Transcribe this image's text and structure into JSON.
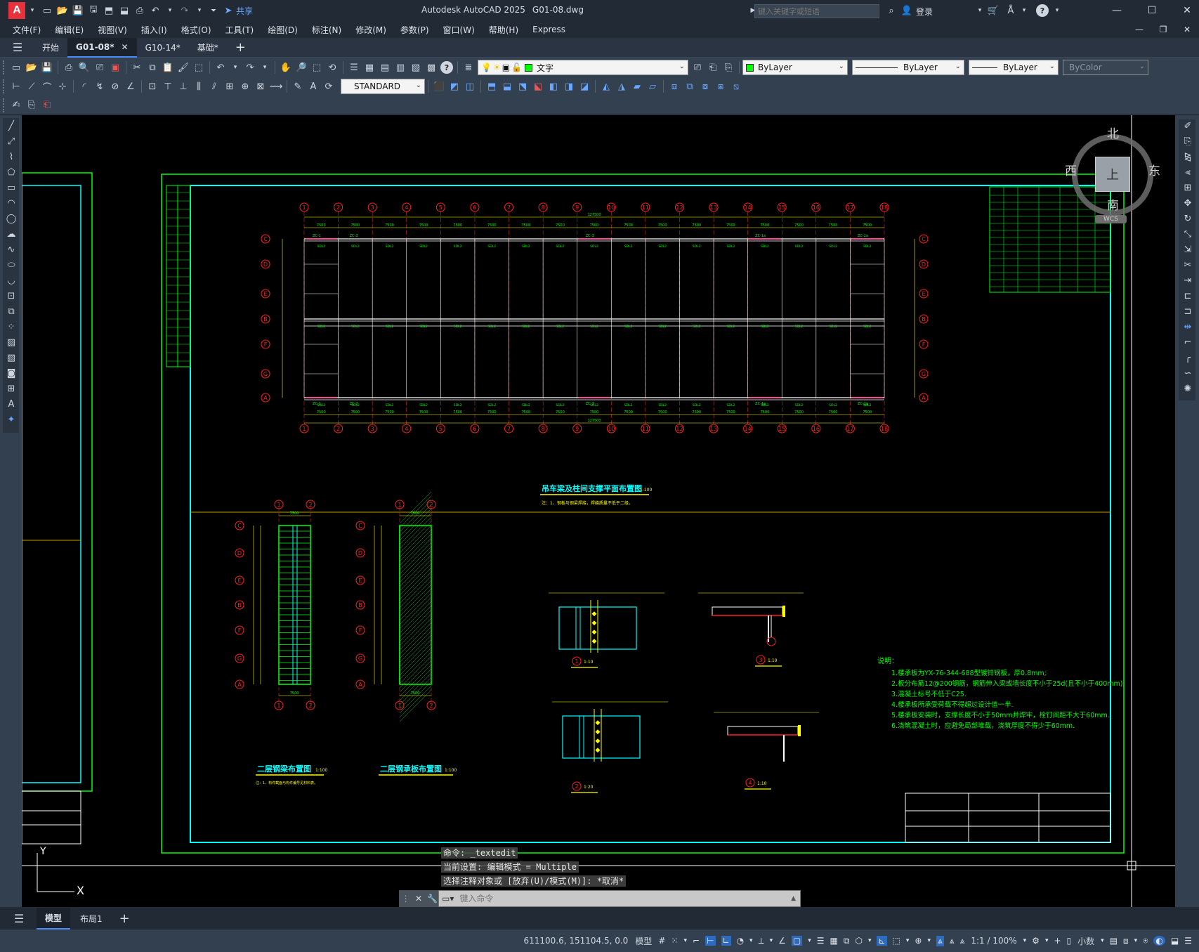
{
  "app": {
    "logo": "A",
    "title": "Autodesk AutoCAD 2025",
    "filename": "G01-08.dwg",
    "share_label": "共享",
    "search_placeholder": "键入关键字或短语",
    "login_label": "登录",
    "accent": "#e8313a"
  },
  "menu": [
    "文件(F)",
    "编辑(E)",
    "视图(V)",
    "插入(I)",
    "格式(O)",
    "工具(T)",
    "绘图(D)",
    "标注(N)",
    "修改(M)",
    "参数(P)",
    "窗口(W)",
    "帮助(H)",
    "Express"
  ],
  "tabs": {
    "start": "开始",
    "items": [
      {
        "label": "G01-08*",
        "active": true
      },
      {
        "label": "G10-14*",
        "active": false
      },
      {
        "label": "基础*",
        "active": false
      }
    ],
    "add": "+"
  },
  "toolbar": {
    "layer_name": "文字",
    "layer_color": "#00ff00",
    "color_combo": "ByLayer",
    "linetype_combo": "ByLayer",
    "lineweight_combo": "ByLayer",
    "plotstyle_combo": "ByColor",
    "textstyle_combo": "STANDARD"
  },
  "viewcube": {
    "north": "北",
    "south": "南",
    "east": "东",
    "west": "西",
    "top": "上",
    "wcs": "WCS"
  },
  "drawing": {
    "main_title": "吊车梁及柱间支撑平面布置图",
    "main_scale": "1:100",
    "main_note": "注：1、钢板与钢梁焊接，焊缝质量不低于二级。",
    "col_labels": [
      "1",
      "2",
      "3",
      "4",
      "5",
      "6",
      "7",
      "8",
      "9",
      "10",
      "11",
      "12",
      "13",
      "14",
      "15",
      "16",
      "17",
      "18"
    ],
    "row_labels": [
      "C",
      "D",
      "E",
      "B",
      "F",
      "G",
      "A"
    ],
    "span_dims": [
      "7500",
      "7500",
      "7500",
      "7500",
      "7500",
      "7500",
      "7500",
      "7500",
      "7500",
      "7500",
      "7500",
      "7500",
      "7500",
      "7500",
      "7500",
      "7500",
      "7500"
    ],
    "total_dim": "127500",
    "beam_label": "SDL2",
    "brace_labels": [
      "ZC-1",
      "ZC-2",
      "ZC-3",
      "ZC-1a",
      "ZC-2a"
    ],
    "plan2_title": "二层钢梁布置图",
    "plan2_scale": "1:100",
    "plan2_note": "注：1、构件截面与构件编号见材料表。",
    "plan3_title": "二层钢承板布置图",
    "plan3_scale": "1:100",
    "details": [
      {
        "num": "1",
        "scale": "1:10"
      },
      {
        "num": "2",
        "scale": "1:20"
      },
      {
        "num": "3",
        "scale": "1:10"
      },
      {
        "num": "4",
        "scale": "1:10"
      }
    ],
    "notes_title": "说明：",
    "notes": [
      "1.楼承板为YX-76-344-688型镀锌钢板，厚0.8mm;",
      "2.板分布筋12@200钢筋，钢筋伸入梁或墙长度不小于25d(且不小于400mm);",
      "3.混凝土标号不低于C25.",
      "4.楼承板所承受荷载不得超过设计值一半.",
      "5.楼承板安装时，支撑长度不小于50mm并焊牢，栓钉间距不大于60mm.",
      "6.浇筑混凝土时，应避免局部堆载，浇筑厚度不得少于60mm."
    ]
  },
  "command": {
    "history": [
      "命令: _textedit",
      "当前设置: 编辑模式 = Multiple",
      "选择注释对象或 [放弃(U)/模式(M)]: *取消*"
    ],
    "placeholder": "键入命令"
  },
  "layout_tabs": [
    "模型",
    "布局1"
  ],
  "status": {
    "coords": "611100.6, 151104.5, 0.0",
    "model": "模型",
    "scale": "1:1 / 100%",
    "units": "小数"
  },
  "ucs": {
    "x": "X",
    "y": "Y"
  }
}
